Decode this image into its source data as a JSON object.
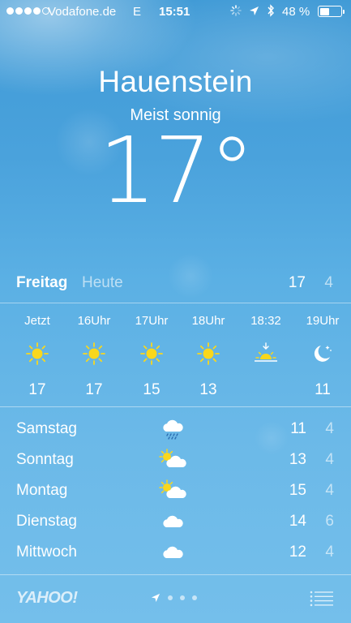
{
  "status_bar": {
    "carrier": "Vodafone.de",
    "network": "E",
    "time": "15:51",
    "battery_percent": "48 %",
    "battery_level": 0.48
  },
  "header": {
    "city": "Hauenstein",
    "condition": "Meist sonnig",
    "temperature": "17°"
  },
  "today": {
    "day": "Freitag",
    "label": "Heute",
    "high": "17",
    "low": "4"
  },
  "hourly": [
    {
      "label": "Jetzt",
      "icon": "sun-icon",
      "temp": "17"
    },
    {
      "label": "16Uhr",
      "icon": "sun-icon",
      "temp": "17"
    },
    {
      "label": "17Uhr",
      "icon": "sun-icon",
      "temp": "15"
    },
    {
      "label": "18Uhr",
      "icon": "sun-icon",
      "temp": "13"
    },
    {
      "label": "18:32",
      "icon": "sunset-icon",
      "temp": ""
    },
    {
      "label": "19Uhr",
      "icon": "moon-stars-icon",
      "temp": "11"
    }
  ],
  "daily": [
    {
      "day": "Samstag",
      "icon": "rain-cloud-icon",
      "high": "11",
      "low": "4"
    },
    {
      "day": "Sonntag",
      "icon": "partly-sunny-icon",
      "high": "13",
      "low": "4"
    },
    {
      "day": "Montag",
      "icon": "partly-sunny-icon",
      "high": "15",
      "low": "4"
    },
    {
      "day": "Dienstag",
      "icon": "cloud-icon",
      "high": "14",
      "low": "6"
    },
    {
      "day": "Mittwoch",
      "icon": "cloud-icon",
      "high": "12",
      "low": "4"
    }
  ],
  "footer": {
    "logo": "YAHOO!",
    "page_count": 3
  },
  "colors": {
    "sky_top": "#3f9ad6",
    "sky_bottom": "#74bfeb",
    "sun": "#f9d71c",
    "text": "#ffffff"
  }
}
